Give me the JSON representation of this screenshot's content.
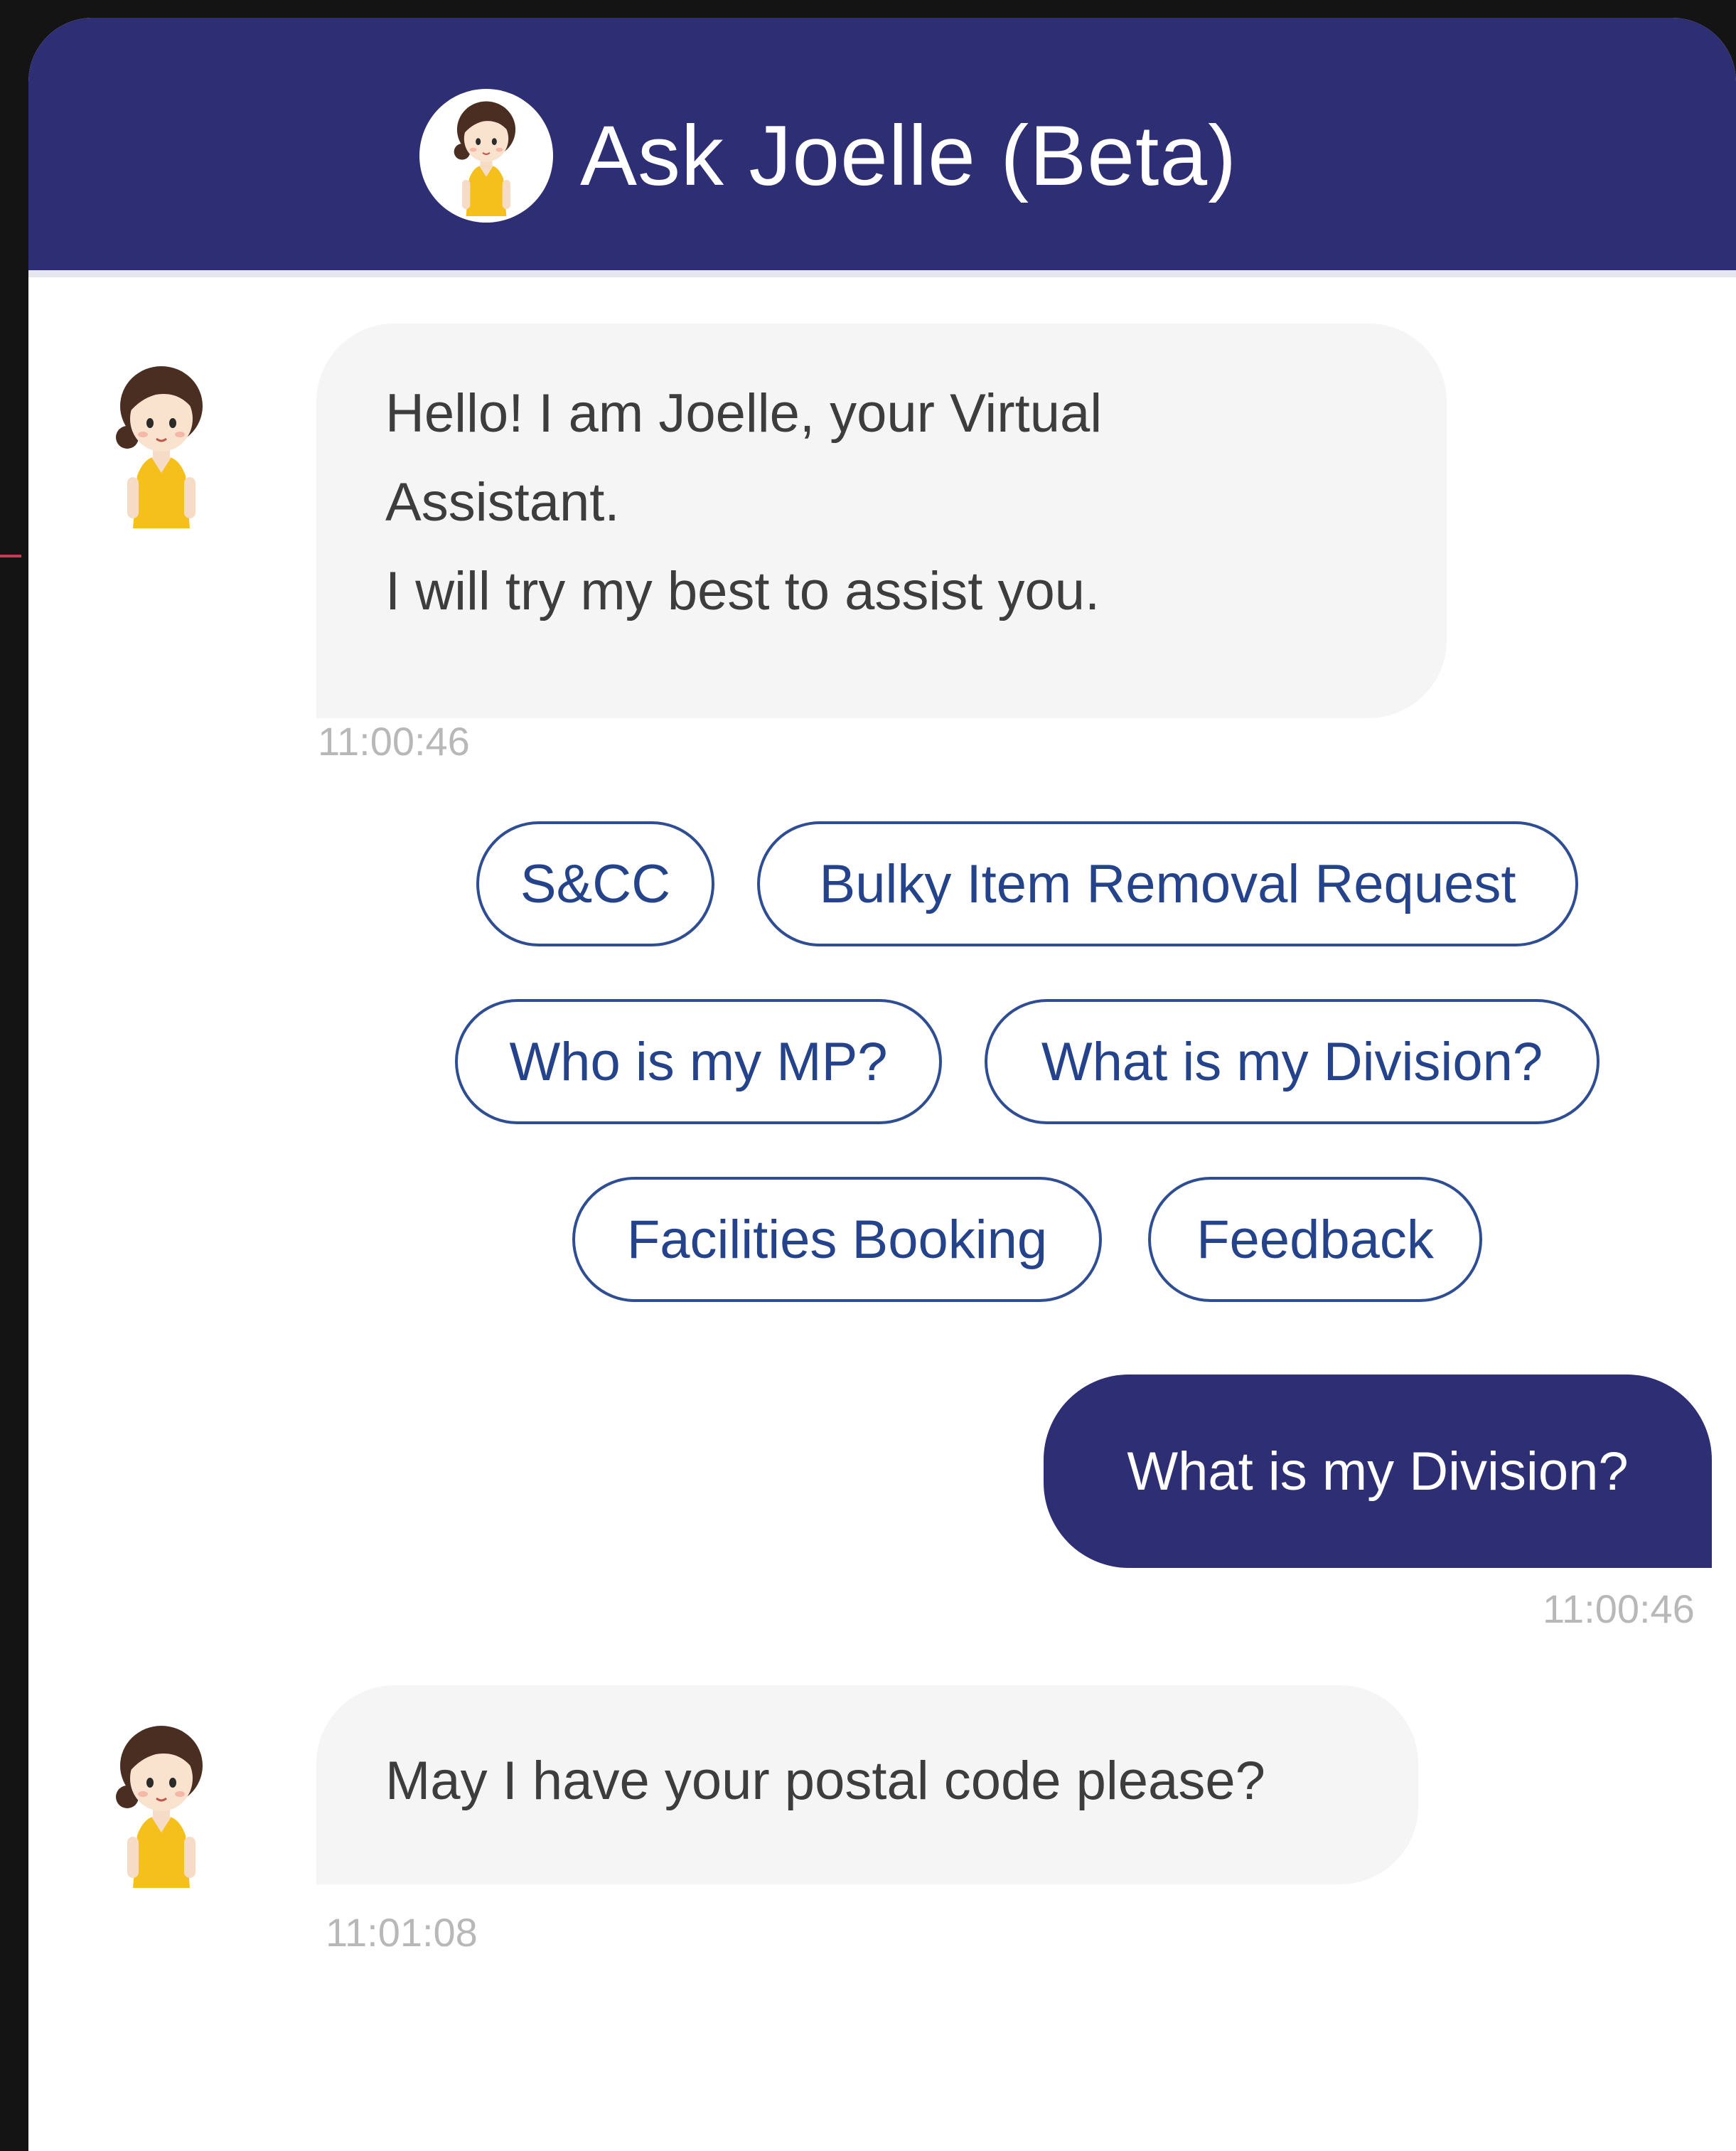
{
  "header": {
    "title": "Ask Joelle (Beta)"
  },
  "messages": [
    {
      "sender": "bot",
      "lines": [
        "Hello! I am Joelle, your Virtual",
        "Assistant.",
        "I will try my best to assist you."
      ],
      "time": "11:00:46"
    },
    {
      "sender": "user",
      "text": "What is my Division?",
      "time": "11:00:46"
    },
    {
      "sender": "bot",
      "lines": [
        "May I have your postal code please?"
      ],
      "time": "11:01:08"
    }
  ],
  "quick_replies": [
    "S&CC",
    "Bulky Item Removal Request",
    "Who is my MP?",
    "What is my Division?",
    "Facilities Booking",
    "Feedback"
  ],
  "colors": {
    "brand": "#2e2e74",
    "chip_border": "#2e4d92",
    "bot_bubble": "#f5f5f5",
    "timestamp": "#b8b8b8"
  }
}
